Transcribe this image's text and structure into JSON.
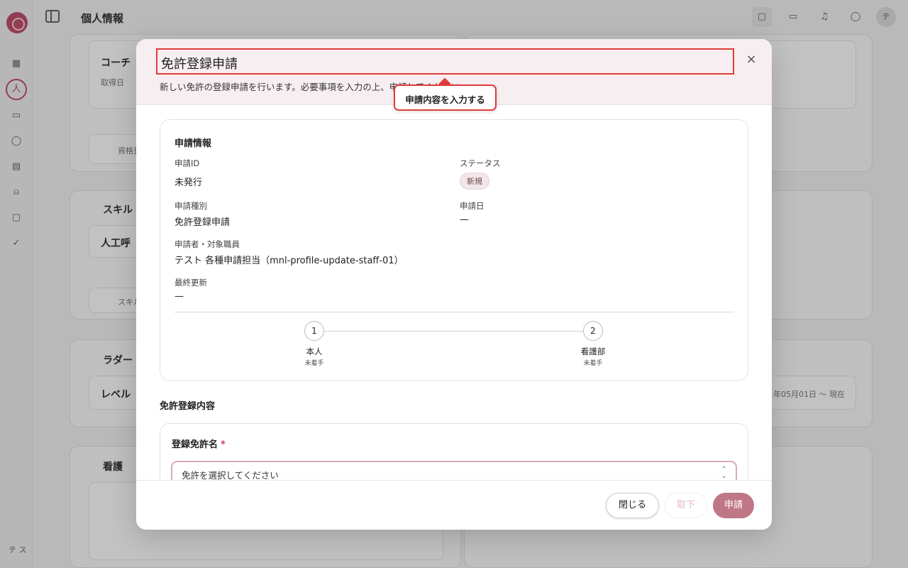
{
  "app": {
    "page_title": "個人情報",
    "user_initials": "テ ス",
    "avatar_initial": "テ",
    "bg_cards": {
      "card1_title": "コーチ",
      "card1_sub": "取得日",
      "card2_btn": "資格登",
      "card3_title": "スキル",
      "card3_item": "人工呼",
      "card4_btn": "スキル",
      "card5_title": "ラダー",
      "card5_item": "レベル",
      "card6_title": "看護",
      "card7_date": "年05月01日 〜 現在"
    }
  },
  "modal": {
    "title": "免許登録申請",
    "description": "新しい免許の登録申請を行います。必要事項を入力の上、申請してください。",
    "close_icon": "×",
    "info_section": {
      "heading": "申請情報",
      "fields": {
        "application_id_label": "申請ID",
        "application_id_value": "未発行",
        "status_label": "ステータス",
        "status_value": "新規",
        "application_type_label": "申請種別",
        "application_type_value": "免許登録申請",
        "application_date_label": "申請日",
        "application_date_value": "—",
        "applicant_label": "申請者・対象職員",
        "applicant_value": "テスト 各種申請担当（mnl-profile-update-staff-01）",
        "last_updated_label": "最終更新",
        "last_updated_value": "—"
      },
      "steps": [
        {
          "number": "1",
          "name": "本人",
          "status": "未着手"
        },
        {
          "number": "2",
          "name": "看護部",
          "status": "未着手"
        }
      ]
    },
    "license_section": {
      "heading": "免許登録内容",
      "license_name_label": "登録免許名",
      "required_mark": "*",
      "select_placeholder": "免許を選択してください",
      "select_chevron_up": "⌃",
      "select_chevron_down": "⌄"
    },
    "footer": {
      "close_label": "閉じる",
      "withdraw_label": "取下",
      "submit_label": "申請"
    }
  },
  "tooltip": {
    "text": "申請内容を入力する"
  },
  "colors": {
    "accent": "#bf7786",
    "highlight": "#e23b3b",
    "header_bg": "#f6eef0"
  }
}
